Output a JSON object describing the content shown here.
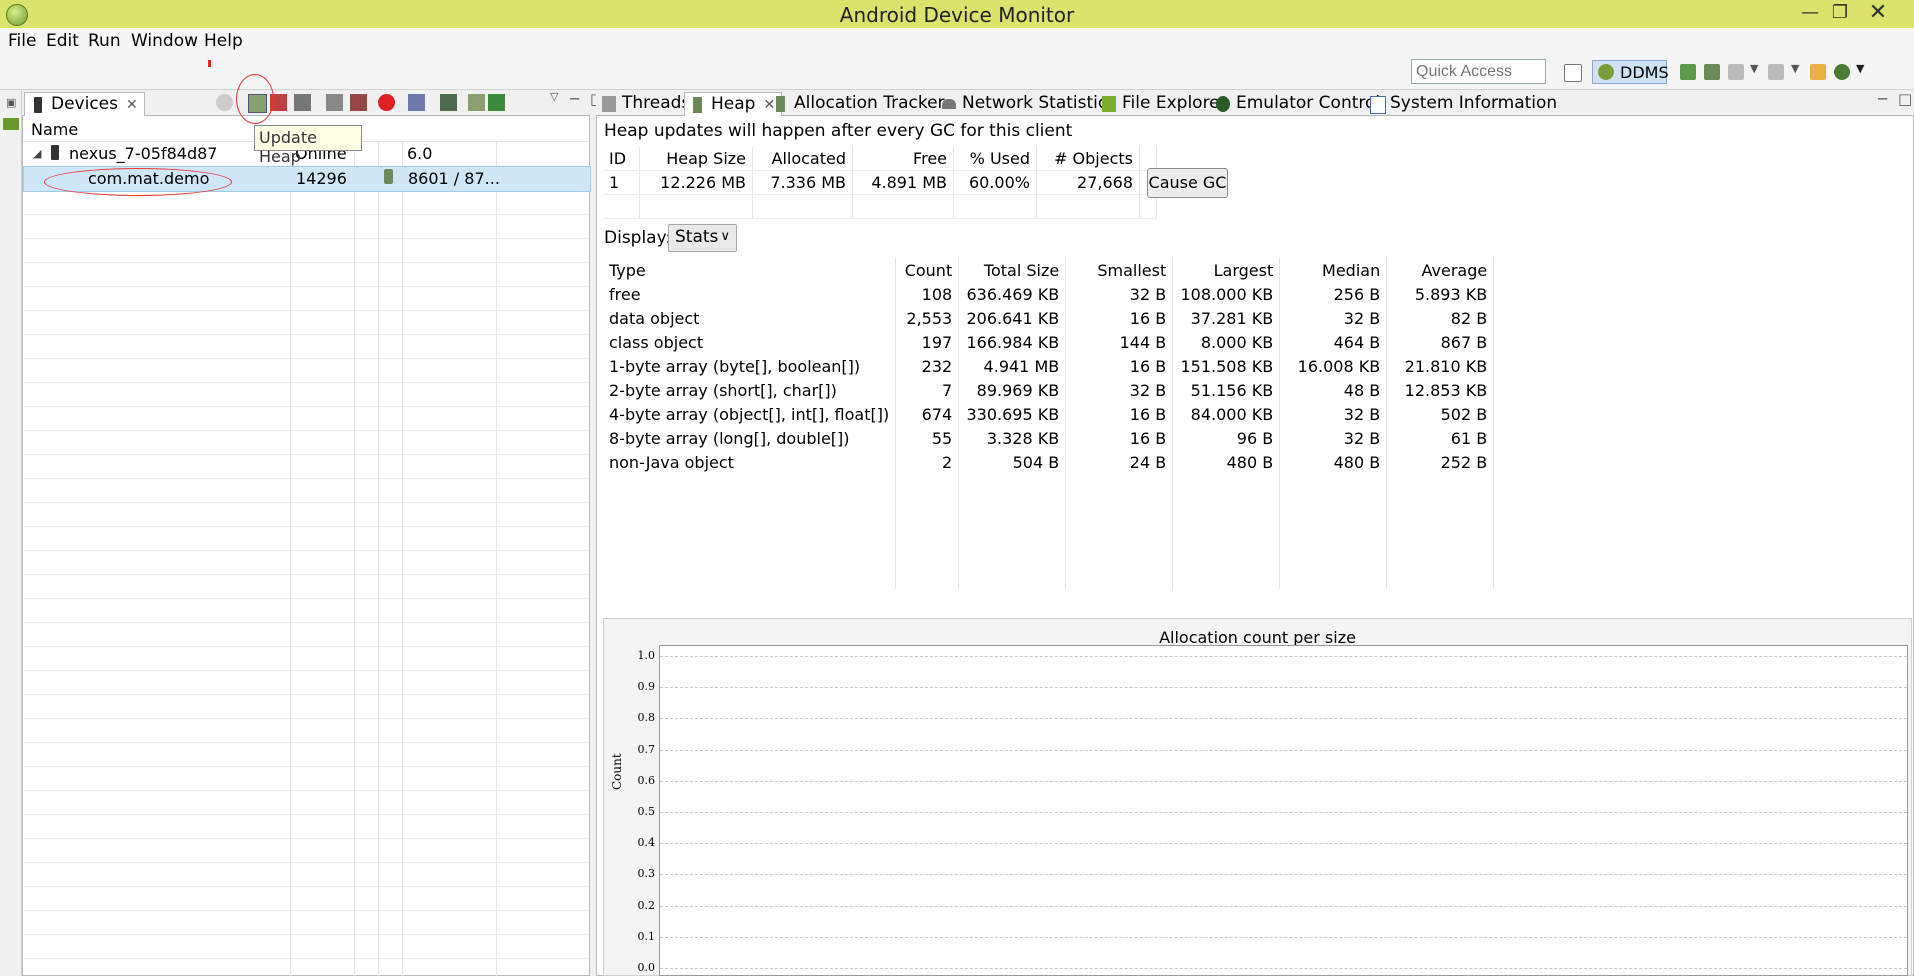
{
  "window": {
    "title": "Android Device Monitor"
  },
  "menubar": {
    "items": [
      "File",
      "Edit",
      "Run",
      "Window",
      "Help"
    ]
  },
  "toolbar": {
    "quick_access_placeholder": "Quick Access",
    "perspective": "DDMS"
  },
  "devices_panel": {
    "tab_label": "Devices",
    "column_name": "Name",
    "tooltip": "Update Heap",
    "device": {
      "name": "nexus_7-05f84d87",
      "status": "Online",
      "version": "6.0"
    },
    "process": {
      "name": "com.mat.demo",
      "pid": "14296",
      "port": "8601 / 87..."
    }
  },
  "heap_panel": {
    "tabs": [
      "Threads",
      "Heap",
      "Allocation Tracker",
      "Network Statistics",
      "File Explorer",
      "Emulator Control",
      "System Information"
    ],
    "note": "Heap updates will happen after every GC for this client",
    "summary_headers": [
      "ID",
      "Heap Size",
      "Allocated",
      "Free",
      "% Used",
      "# Objects"
    ],
    "summary_row": [
      "1",
      "12.226 MB",
      "7.336 MB",
      "4.891 MB",
      "60.00%",
      "27,668"
    ],
    "cause_gc_label": "Cause GC",
    "display_label": "Display:",
    "display_value": "Stats",
    "stats_headers": [
      "Type",
      "Count",
      "Total Size",
      "Smallest",
      "Largest",
      "Median",
      "Average"
    ],
    "stats_rows": [
      [
        "free",
        "108",
        "636.469 KB",
        "32 B",
        "108.000 KB",
        "256 B",
        "5.893 KB"
      ],
      [
        "data object",
        "2,553",
        "206.641 KB",
        "16 B",
        "37.281 KB",
        "32 B",
        "82 B"
      ],
      [
        "class object",
        "197",
        "166.984 KB",
        "144 B",
        "8.000 KB",
        "464 B",
        "867 B"
      ],
      [
        "1-byte array (byte[], boolean[])",
        "232",
        "4.941 MB",
        "16 B",
        "151.508 KB",
        "16.008 KB",
        "21.810 KB"
      ],
      [
        "2-byte array (short[], char[])",
        "7",
        "89.969 KB",
        "32 B",
        "51.156 KB",
        "48 B",
        "12.853 KB"
      ],
      [
        "4-byte array (object[], int[], float[])",
        "674",
        "330.695 KB",
        "16 B",
        "84.000 KB",
        "32 B",
        "502 B"
      ],
      [
        "8-byte array (long[], double[])",
        "55",
        "3.328 KB",
        "16 B",
        "96 B",
        "32 B",
        "61 B"
      ],
      [
        "non-Java object",
        "2",
        "504 B",
        "24 B",
        "480 B",
        "480 B",
        "252 B"
      ]
    ]
  },
  "chart_data": {
    "type": "bar",
    "title": "Allocation count per size",
    "xlabel": "",
    "ylabel": "Count",
    "ylim": [
      0.0,
      1.0
    ],
    "yticks": [
      "1.0",
      "0.9",
      "0.8",
      "0.7",
      "0.6",
      "0.5",
      "0.4",
      "0.3",
      "0.2",
      "0.1",
      "0.0"
    ],
    "categories": [],
    "values": [],
    "grid": true
  }
}
